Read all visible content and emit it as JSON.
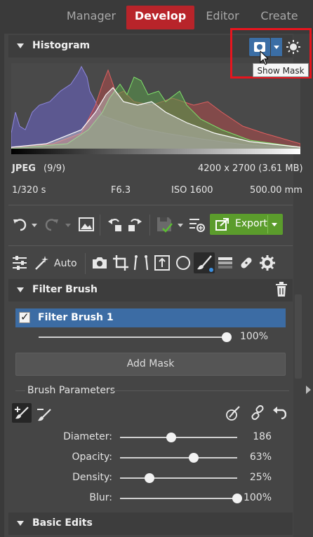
{
  "tabs": [
    {
      "label": "Manager",
      "active": false
    },
    {
      "label": "Develop",
      "active": true
    },
    {
      "label": "Editor",
      "active": false
    },
    {
      "label": "Create",
      "active": false
    }
  ],
  "histogram": {
    "title": "Histogram",
    "tooltip": "Show Mask",
    "icons": {
      "mask": "mask-icon",
      "exposure": "exposure-warning-icon"
    }
  },
  "image_info": {
    "format": "JPEG",
    "index": "(9/9)",
    "dimensions": "4200 x 2700 (3.61 MB)",
    "shutter": "1/320 s",
    "aperture": "F6.3",
    "iso": "ISO 1600",
    "focal": "500.00 mm"
  },
  "toolbar": {
    "export_label": "Export",
    "auto_label": "Auto"
  },
  "filter_brush": {
    "title": "Filter Brush",
    "layer_name": "Filter Brush 1",
    "layer_opacity": "100%",
    "layer_opacity_value": 1.0,
    "add_mask_label": "Add Mask",
    "params_title": "Brush Parameters",
    "params": [
      {
        "label": "Diameter:",
        "value": "186",
        "fraction": 0.44
      },
      {
        "label": "Opacity:",
        "value": "63%",
        "fraction": 0.63
      },
      {
        "label": "Density:",
        "value": "25%",
        "fraction": 0.25
      },
      {
        "label": "Blur:",
        "value": "100%",
        "fraction": 1.0
      }
    ]
  },
  "basic_edits": {
    "title": "Basic Edits"
  },
  "colors": {
    "accent_red": "#b8242a",
    "selection_blue": "#3c6ca4",
    "export_green": "#5b9c2c",
    "highlight_box": "#e8151e"
  }
}
